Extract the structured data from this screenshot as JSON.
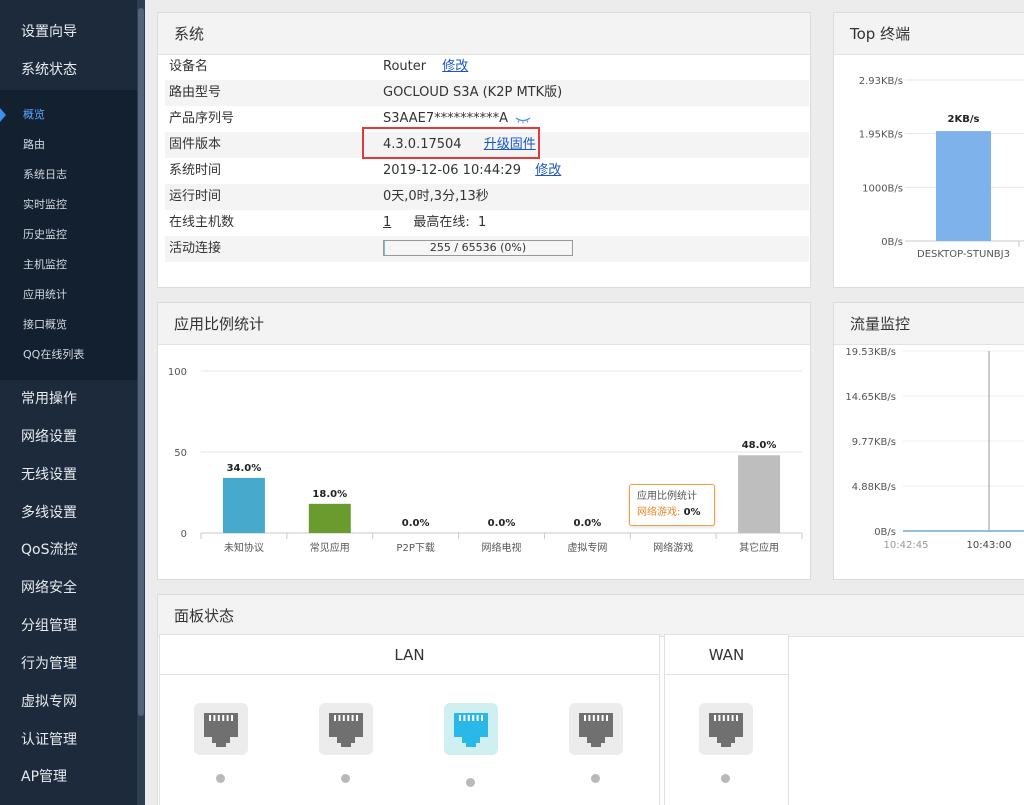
{
  "sidebar": {
    "top_items": [
      "设置向导",
      "系统状态"
    ],
    "sub_items": [
      "概览",
      "路由",
      "系统日志",
      "实时监控",
      "历史监控",
      "主机监控",
      "应用统计",
      "接口概览",
      "QQ在线列表"
    ],
    "active_sub": "概览",
    "bottom_items": [
      "常用操作",
      "网络设置",
      "无线设置",
      "多线设置",
      "QoS流控",
      "网络安全",
      "分组管理",
      "行为管理",
      "虚拟专网",
      "认证管理",
      "AP管理"
    ]
  },
  "system": {
    "title": "系统",
    "rows": [
      {
        "key": "设备名",
        "value": "Router",
        "link": "修改"
      },
      {
        "key": "路由型号",
        "value": "GOCLOUD S3A (K2P MTK版)"
      },
      {
        "key": "产品序列号",
        "value": "S3AAE7**********A"
      },
      {
        "key": "固件版本",
        "value": "4.3.0.17504",
        "link": "升级固件"
      },
      {
        "key": "系统时间",
        "value": "2019-12-06 10:44:29",
        "link": "修改"
      },
      {
        "key": "运行时间",
        "value": "0天,0时,3分,13秒"
      },
      {
        "key": "在线主机数",
        "value": "1",
        "extra_label": "最高在线:",
        "extra_value": "1"
      },
      {
        "key": "活动连接",
        "value": "255 / 65536 (0%)"
      }
    ],
    "active_conn_fraction": 0.0039
  },
  "top_terminal": {
    "title": "Top 终端",
    "chart_data": {
      "type": "bar",
      "categories": [
        "DESKTOP-STUNBJ3"
      ],
      "values": [
        2048
      ],
      "data_labels": [
        "2KB/s"
      ],
      "ytick_labels": [
        "2.93KB/s",
        "1.95KB/s",
        "1000B/s",
        "0B/s"
      ],
      "ytick_values": [
        3000,
        2000,
        1000,
        0
      ],
      "color": "#7db3ea"
    }
  },
  "app_ratio": {
    "title": "应用比例统计",
    "chart_data": {
      "type": "bar",
      "categories": [
        "未知协议",
        "常见应用",
        "P2P下载",
        "网络电视",
        "虚拟专网",
        "网络游戏",
        "其它应用"
      ],
      "values": [
        34.0,
        18.0,
        0.0,
        0.0,
        0.0,
        0.0,
        48.0
      ],
      "data_labels": [
        "34.0%",
        "18.0%",
        "0.0%",
        "0.0%",
        "0.0%",
        "0.0%",
        "48.0%"
      ],
      "colors": [
        "#47a9cc",
        "#6b9a2e",
        "#999999",
        "#999999",
        "#999999",
        "#999999",
        "#bebebe"
      ],
      "yticks": [
        0,
        50,
        100
      ],
      "ylim": [
        0,
        100
      ]
    },
    "tooltip": {
      "title": "应用比例统计",
      "series": "网络游戏:",
      "value": "0%"
    }
  },
  "traffic": {
    "title": "流量监控",
    "chart_data": {
      "type": "line",
      "ytick_labels": [
        "19.53KB/s",
        "14.65KB/s",
        "9.77KB/s",
        "4.88KB/s",
        "0B/s"
      ],
      "xtick_labels": [
        "10:42:45",
        "10:43:00"
      ]
    }
  },
  "panel_status": {
    "title": "面板状态",
    "lan_label": "LAN",
    "wan_label": "WAN",
    "lan_ports": [
      {
        "state": "inactive"
      },
      {
        "state": "inactive"
      },
      {
        "state": "active"
      },
      {
        "state": "inactive"
      }
    ],
    "wan_ports": [
      {
        "state": "inactive"
      }
    ],
    "colors": {
      "inactive": "#707070",
      "active": "#29b8e8"
    }
  }
}
